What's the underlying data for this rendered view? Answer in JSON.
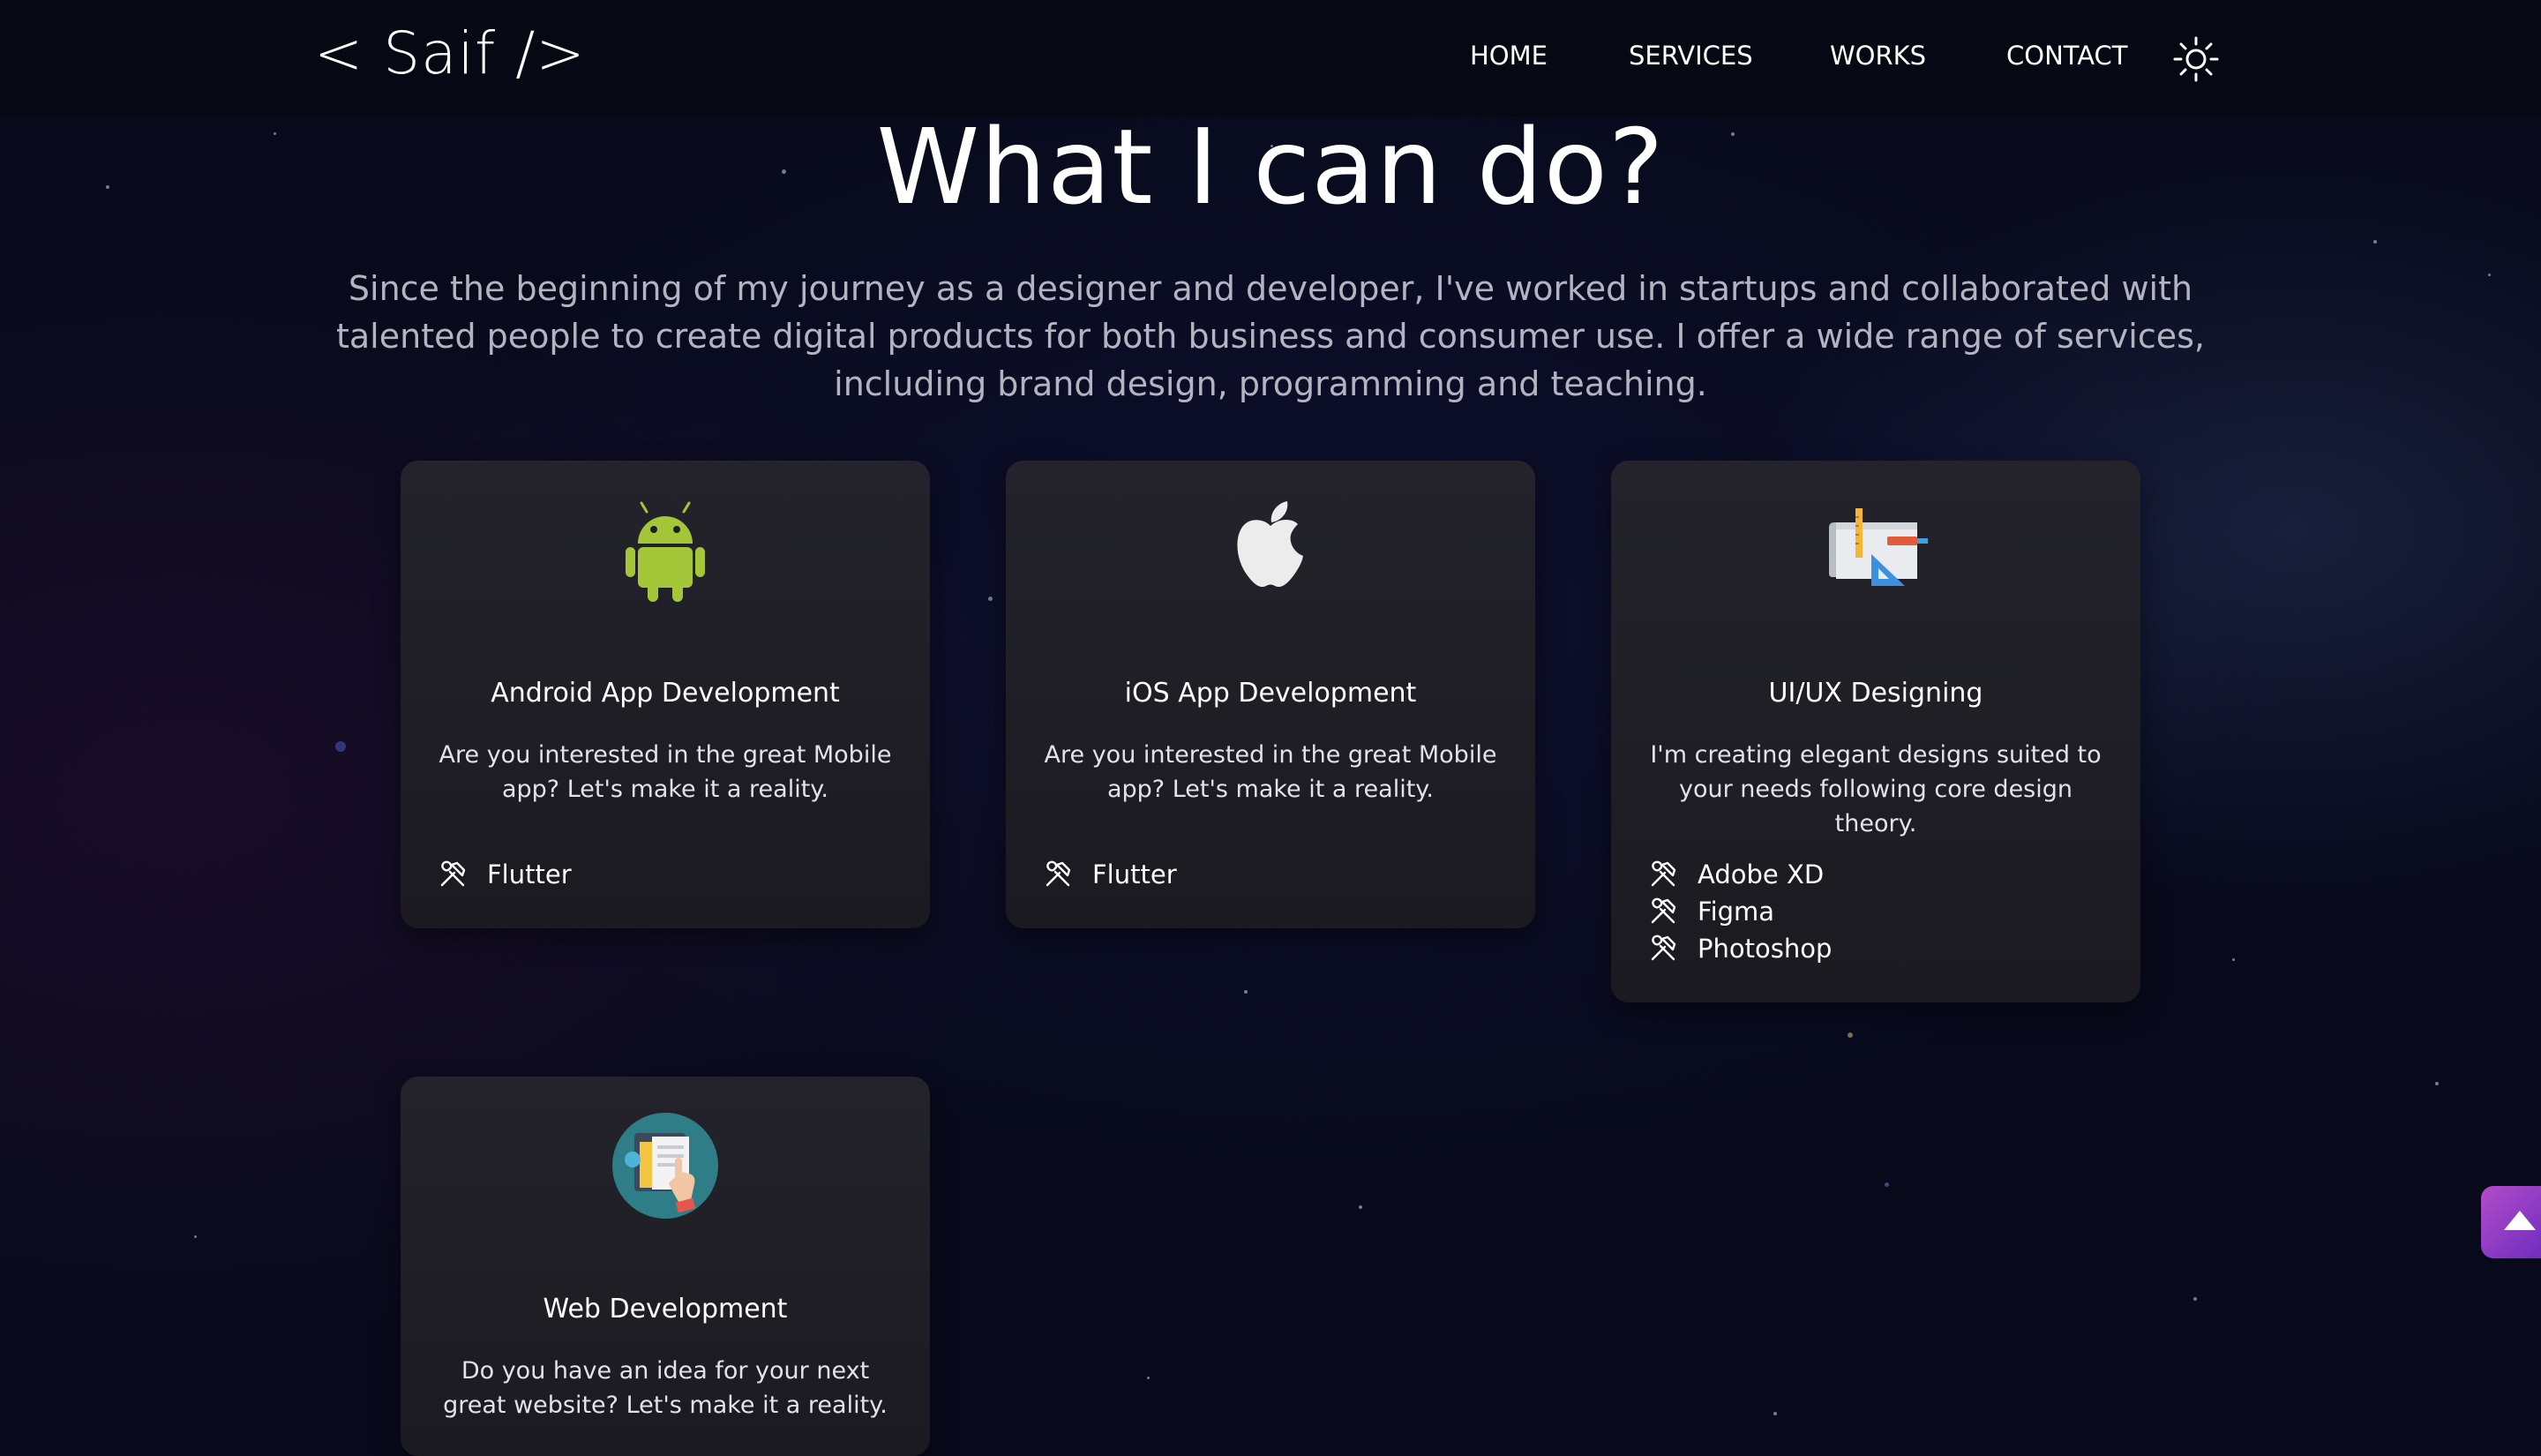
{
  "nav": {
    "logo": "< Saif />",
    "items": [
      "HOME",
      "SERVICES",
      "WORKS",
      "CONTACT"
    ],
    "theme_icon": "sun-icon"
  },
  "section": {
    "title": "What I can do?",
    "intro": "Since the beginning of my journey as a designer and developer, I've worked in startups and collaborated with talented people to create digital products for both business and consumer use. I offer a wide range of services, including brand design, programming and teaching."
  },
  "services": [
    {
      "icon": "android-icon",
      "title": "Android App Development",
      "description": "Are you interested in the great Mobile app? Let's make it a reality.",
      "tools": [
        "Flutter"
      ]
    },
    {
      "icon": "apple-icon",
      "title": "iOS App Development",
      "description": "Are you interested in the great Mobile app? Let's make it a reality.",
      "tools": [
        "Flutter"
      ]
    },
    {
      "icon": "design-tools-icon",
      "title": "UI/UX Designing",
      "description": "I'm creating elegant designs suited to your needs following core design theory.",
      "tools": [
        "Adobe XD",
        "Figma",
        "Photoshop"
      ]
    },
    {
      "icon": "web-development-icon",
      "title": "Web Development",
      "description": "Do you have an idea for your next great website? Let's make it a reality.",
      "tools": []
    }
  ],
  "tool_icon": "tools-icon",
  "scroll_top_icon": "arrow-up-icon",
  "colors": {
    "background": "#080a1c",
    "card": "#222128",
    "android_green": "#a4c639",
    "scroll_button": "#9b3fc6"
  }
}
